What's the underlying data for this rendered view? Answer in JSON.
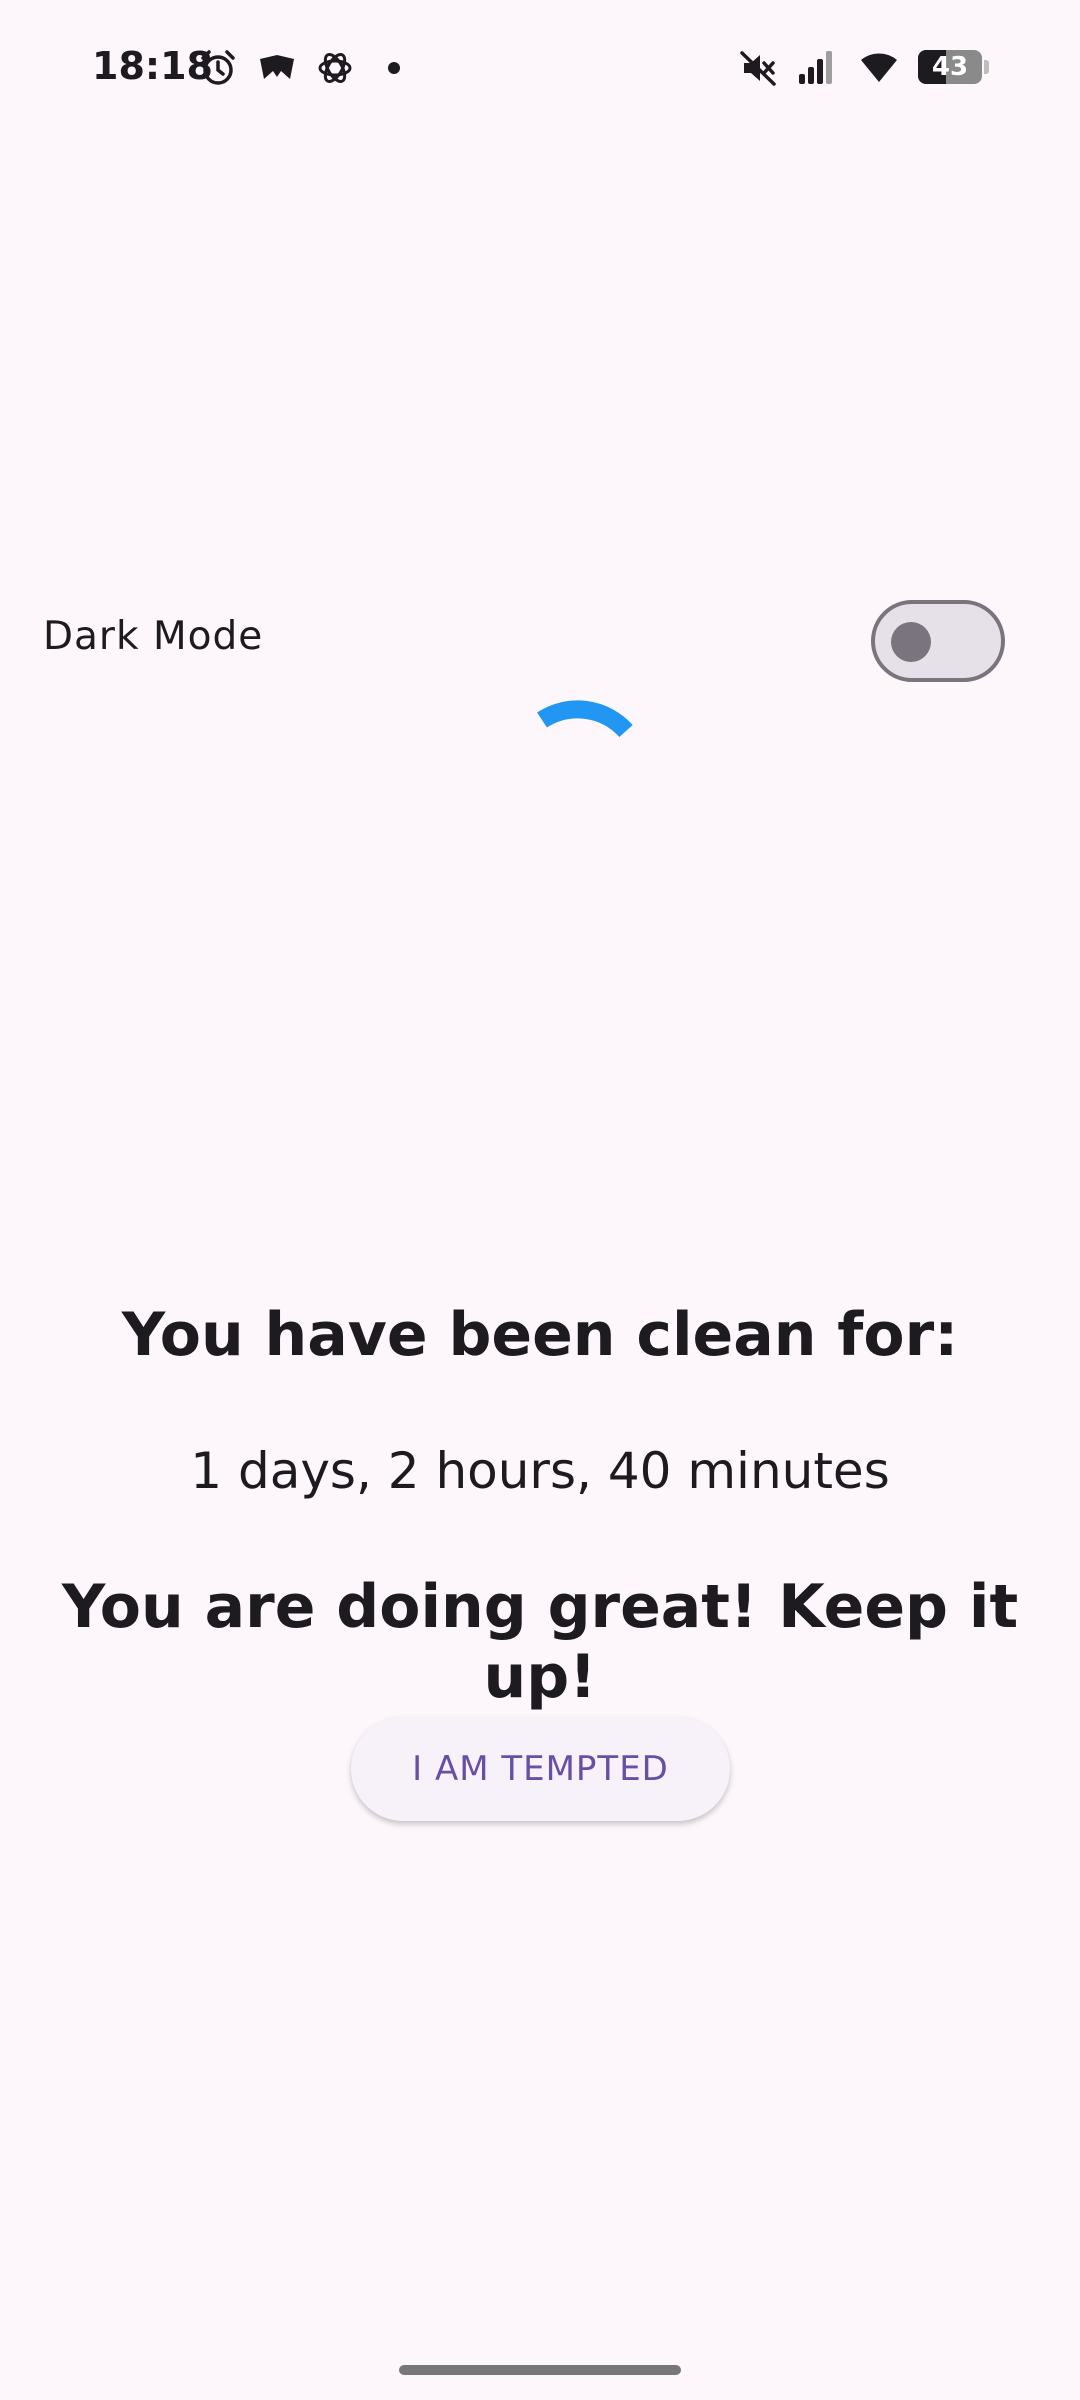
{
  "status_bar": {
    "time": "18:18",
    "icons_left": [
      "alarm-icon",
      "notification-app-icon",
      "openai-icon",
      "more-notifications-dot"
    ],
    "icons_right": [
      "mute-icon",
      "signal-icon",
      "wifi-icon",
      "battery-icon"
    ],
    "battery_level": "43",
    "battery_fraction": 0.43
  },
  "settings": {
    "dark_mode_label": "Dark Mode",
    "dark_mode_enabled": false
  },
  "main": {
    "clean_title": "You have been clean for:",
    "clean_duration": "1 days, 2 hours, 40 minutes",
    "encouragement": "You are doing great! Keep it up!",
    "tempted_button_label": "I AM TEMPTED"
  },
  "colors": {
    "background": "#FDF7FC",
    "text": "#1D1B20",
    "accent": "#6750A4",
    "spinner": "#2196F3",
    "switch_outline": "#79747E"
  }
}
